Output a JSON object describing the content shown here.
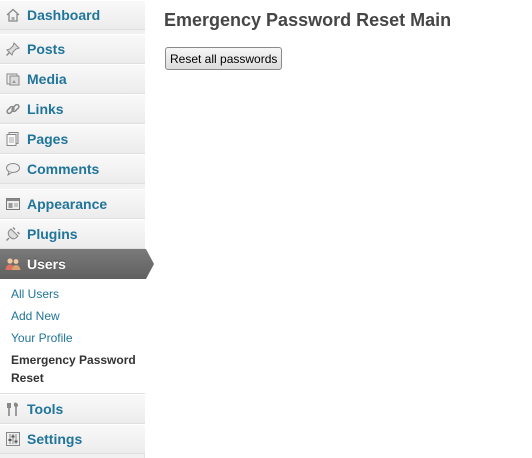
{
  "menu": {
    "dashboard": "Dashboard",
    "posts": "Posts",
    "media": "Media",
    "links": "Links",
    "pages": "Pages",
    "comments": "Comments",
    "appearance": "Appearance",
    "plugins": "Plugins",
    "users": "Users",
    "tools": "Tools",
    "settings": "Settings"
  },
  "submenu": {
    "all_users": "All Users",
    "add_new": "Add New",
    "your_profile": "Your Profile",
    "current": "Emergency Password Reset"
  },
  "main": {
    "title": "Emergency Password Reset Main",
    "reset_button": "Reset all passwords"
  },
  "icons": {
    "dashboard": "house-icon",
    "posts": "pushpin-icon",
    "media": "media-icon",
    "links": "chain-link-icon",
    "pages": "pages-icon",
    "comments": "speech-bubble-icon",
    "appearance": "appearance-icon",
    "plugins": "plug-icon",
    "users": "users-icon",
    "tools": "tools-icon",
    "settings": "sliders-icon"
  },
  "colors": {
    "link": "#21759b",
    "active_bg": "#6d6d6d",
    "sidebar_bg": "#f1f1f1",
    "title": "#464646"
  }
}
